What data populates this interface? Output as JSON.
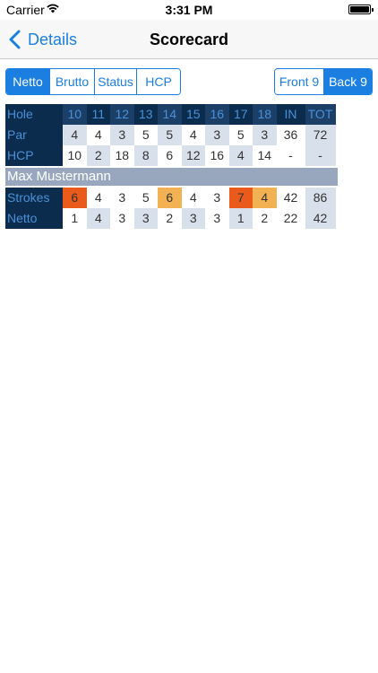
{
  "status_bar": {
    "carrier": "Carrier",
    "time": "3:31 PM"
  },
  "nav": {
    "back_label": "Details",
    "title": "Scorecard"
  },
  "view_tabs": [
    "Netto",
    "Brutto",
    "Status",
    "HCP"
  ],
  "nine_tabs": [
    "Front 9",
    "Back 9"
  ],
  "scorecard": {
    "header": [
      "Hole",
      "10",
      "11",
      "12",
      "13",
      "14",
      "15",
      "16",
      "17",
      "18",
      "IN",
      "TOT"
    ],
    "par": [
      "Par",
      "4",
      "4",
      "3",
      "5",
      "5",
      "4",
      "3",
      "5",
      "3",
      "36",
      "72"
    ],
    "hcp": [
      "HCP",
      "10",
      "2",
      "18",
      "8",
      "6",
      "12",
      "16",
      "4",
      "14",
      "-",
      "-"
    ],
    "player_name": "Max Mustermann",
    "strokes": [
      "Strokes",
      "6",
      "4",
      "3",
      "5",
      "6",
      "4",
      "3",
      "7",
      "4",
      "42",
      "86"
    ],
    "netto": [
      "Netto",
      "1",
      "4",
      "3",
      "3",
      "2",
      "3",
      "3",
      "1",
      "2",
      "22",
      "42"
    ]
  },
  "colors": {
    "accent": "#1a7fe0",
    "header_bg": "#0c2c4d",
    "double_bogey": "#ea5b1b",
    "bogey": "#f2b253"
  }
}
